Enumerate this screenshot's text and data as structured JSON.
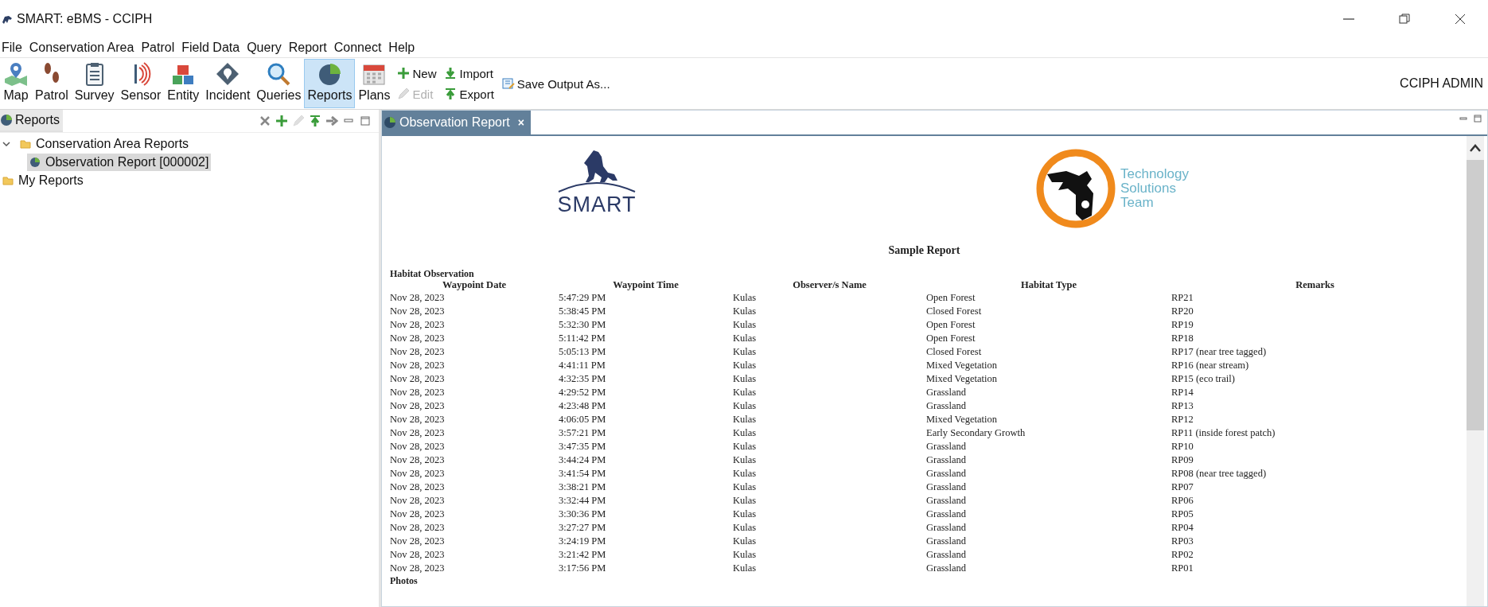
{
  "window": {
    "title": "SMART: eBMS - CCIPH",
    "controls": [
      {
        "kind": "minimize"
      },
      {
        "kind": "restore"
      },
      {
        "kind": "close"
      }
    ]
  },
  "menu": [
    "File",
    "Conservation Area",
    "Patrol",
    "Field Data",
    "Query",
    "Report",
    "Connect",
    "Help"
  ],
  "toolbar": {
    "perspectives": [
      {
        "label": "Map",
        "kind": "map",
        "selected": false
      },
      {
        "label": "Patrol",
        "kind": "patrol",
        "selected": false
      },
      {
        "label": "Survey",
        "kind": "survey",
        "selected": false
      },
      {
        "label": "Sensor",
        "kind": "sensor",
        "selected": false
      },
      {
        "label": "Entity",
        "kind": "entity",
        "selected": false
      },
      {
        "label": "Incident",
        "kind": "incident",
        "selected": false
      },
      {
        "label": "Queries",
        "kind": "queries",
        "selected": false
      },
      {
        "label": "Reports",
        "kind": "reports",
        "selected": true
      },
      {
        "label": "Plans",
        "kind": "plans",
        "selected": false
      }
    ],
    "actions": [
      {
        "label": "New",
        "kind": "new",
        "disabled": false
      },
      {
        "label": "Edit",
        "kind": "edit",
        "disabled": true
      },
      {
        "label": "Import",
        "kind": "import",
        "disabled": false
      },
      {
        "label": "Export",
        "kind": "export",
        "disabled": false
      },
      {
        "label": "Save Output As...",
        "kind": "save",
        "disabled": false
      }
    ],
    "user": "CCIPH ADMIN"
  },
  "sidebar": {
    "tab": "Reports",
    "tools": [
      {
        "kind": "delete",
        "disabled": false
      },
      {
        "kind": "add",
        "disabled": false
      },
      {
        "kind": "edit",
        "disabled": true
      },
      {
        "kind": "upload",
        "disabled": false
      },
      {
        "kind": "forward",
        "disabled": false
      },
      {
        "kind": "minimize",
        "disabled": false
      },
      {
        "kind": "maximize",
        "disabled": false
      }
    ],
    "tree": [
      {
        "label": "Conservation Area Reports",
        "kind": "folder",
        "expanded": true,
        "selected": false,
        "children": [
          {
            "label": "Observation Report [000002]",
            "kind": "report",
            "selected": true
          }
        ]
      },
      {
        "label": "My Reports",
        "kind": "folder",
        "selected": false
      }
    ]
  },
  "editor": {
    "tab": "Observation Report",
    "close": "×",
    "report": {
      "logo_left": "SMART",
      "logo_right": [
        "Technology",
        "Solutions",
        "Team"
      ],
      "title": "Sample Report",
      "section": "Habitat Observation",
      "columns": [
        "Waypoint Date",
        "Waypoint Time",
        "Observer/s Name",
        "Habitat Type",
        "Remarks"
      ],
      "rows": [
        [
          "Nov 28, 2023",
          "5:47:29 PM",
          "Kulas",
          "Open Forest",
          "RP21"
        ],
        [
          "Nov 28, 2023",
          "5:38:45 PM",
          "Kulas",
          "Closed Forest",
          "RP20"
        ],
        [
          "Nov 28, 2023",
          "5:32:30 PM",
          "Kulas",
          "Open Forest",
          "RP19"
        ],
        [
          "Nov 28, 2023",
          "5:11:42 PM",
          "Kulas",
          "Open Forest",
          "RP18"
        ],
        [
          "Nov 28, 2023",
          "5:05:13 PM",
          "Kulas",
          "Closed Forest",
          "RP17 (near tree tagged)"
        ],
        [
          "Nov 28, 2023",
          "4:41:11 PM",
          "Kulas",
          "Mixed Vegetation",
          "RP16 (near stream)"
        ],
        [
          "Nov 28, 2023",
          "4:32:35 PM",
          "Kulas",
          "Mixed Vegetation",
          "RP15 (eco trail)"
        ],
        [
          "Nov 28, 2023",
          "4:29:52 PM",
          "Kulas",
          "Grassland",
          "RP14"
        ],
        [
          "Nov 28, 2023",
          "4:23:48 PM",
          "Kulas",
          "Grassland",
          "RP13"
        ],
        [
          "Nov 28, 2023",
          "4:06:05 PM",
          "Kulas",
          "Mixed Vegetation",
          "RP12"
        ],
        [
          "Nov 28, 2023",
          "3:57:21 PM",
          "Kulas",
          "Early Secondary Growth",
          "RP11 (inside forest patch)"
        ],
        [
          "Nov 28, 2023",
          "3:47:35 PM",
          "Kulas",
          "Grassland",
          "RP10"
        ],
        [
          "Nov 28, 2023",
          "3:44:24 PM",
          "Kulas",
          "Grassland",
          "RP09"
        ],
        [
          "Nov 28, 2023",
          "3:41:54 PM",
          "Kulas",
          "Grassland",
          "RP08 (near tree tagged)"
        ],
        [
          "Nov 28, 2023",
          "3:38:21 PM",
          "Kulas",
          "Grassland",
          "RP07"
        ],
        [
          "Nov 28, 2023",
          "3:32:44 PM",
          "Kulas",
          "Grassland",
          "RP06"
        ],
        [
          "Nov 28, 2023",
          "3:30:36 PM",
          "Kulas",
          "Grassland",
          "RP05"
        ],
        [
          "Nov 28, 2023",
          "3:27:27 PM",
          "Kulas",
          "Grassland",
          "RP04"
        ],
        [
          "Nov 28, 2023",
          "3:24:19 PM",
          "Kulas",
          "Grassland",
          "RP03"
        ],
        [
          "Nov 28, 2023",
          "3:21:42 PM",
          "Kulas",
          "Grassland",
          "RP02"
        ],
        [
          "Nov 28, 2023",
          "3:17:56 PM",
          "Kulas",
          "Grassland",
          "RP01"
        ]
      ],
      "footer": "Photos"
    }
  }
}
